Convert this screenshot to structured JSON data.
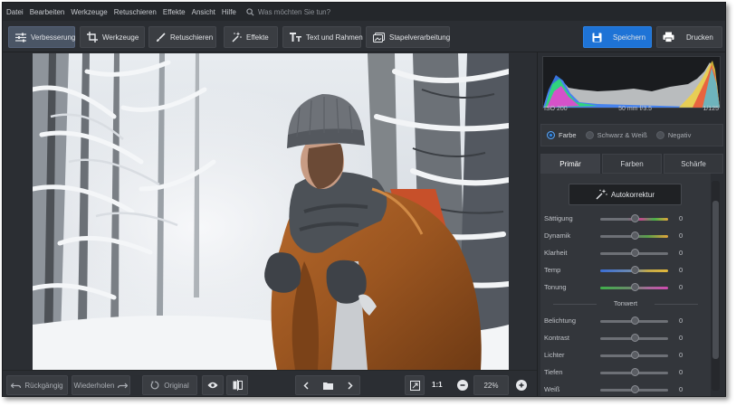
{
  "menu": {
    "items": [
      "Datei",
      "Bearbeiten",
      "Werkzeuge",
      "Retuschieren",
      "Effekte",
      "Ansicht",
      "Hilfe"
    ],
    "search_placeholder": "Was möchten Sie tun?"
  },
  "toolbar": {
    "tabs": [
      {
        "label": "Verbesserung",
        "icon": "sliders-icon",
        "active": true
      },
      {
        "label": "Werkzeuge",
        "icon": "crop-icon",
        "active": false
      },
      {
        "label": "Retuschieren",
        "icon": "brush-icon",
        "active": false
      },
      {
        "label": "Effekte",
        "icon": "magic-wand-icon",
        "active": false
      },
      {
        "label": "Text und Rahmen",
        "icon": "text-icon",
        "active": false
      },
      {
        "label": "Stapelverarbeitung",
        "icon": "batch-icon",
        "active": false
      }
    ],
    "save_label": "Speichern",
    "print_label": "Drucken"
  },
  "bottom": {
    "undo_label": "Rückgängig",
    "redo_label": "Wiederholen",
    "original_label": "Original",
    "ratio_label": "1:1",
    "zoom_value": "22%"
  },
  "histogram": {
    "iso": "ISO 200",
    "lens": "50 mm f/3.5",
    "shutter": "1/125"
  },
  "color_mode": {
    "options": [
      "Farbe",
      "Schwarz & Weiß",
      "Negativ"
    ],
    "selected": "Farbe"
  },
  "panel_tabs": [
    "Primär",
    "Farben",
    "Schärfe"
  ],
  "adjustments": {
    "auto_label": "Autokorrektur",
    "sliders": [
      {
        "label": "Sättigung",
        "value": "0"
      },
      {
        "label": "Dynamik",
        "value": "0"
      },
      {
        "label": "Klarheit",
        "value": "0"
      },
      {
        "label": "Temp",
        "value": "0"
      },
      {
        "label": "Tonung",
        "value": "0"
      }
    ],
    "tone_section": "Tonwert",
    "tone_sliders": [
      {
        "label": "Belichtung",
        "value": "0"
      },
      {
        "label": "Kontrast",
        "value": "0"
      },
      {
        "label": "Lichter",
        "value": "0"
      },
      {
        "label": "Tiefen",
        "value": "0"
      },
      {
        "label": "Weiß",
        "value": "0"
      }
    ]
  },
  "colors": {
    "accent": "#1e73d6",
    "background": "#2b2e33",
    "panel": "#33363b"
  }
}
